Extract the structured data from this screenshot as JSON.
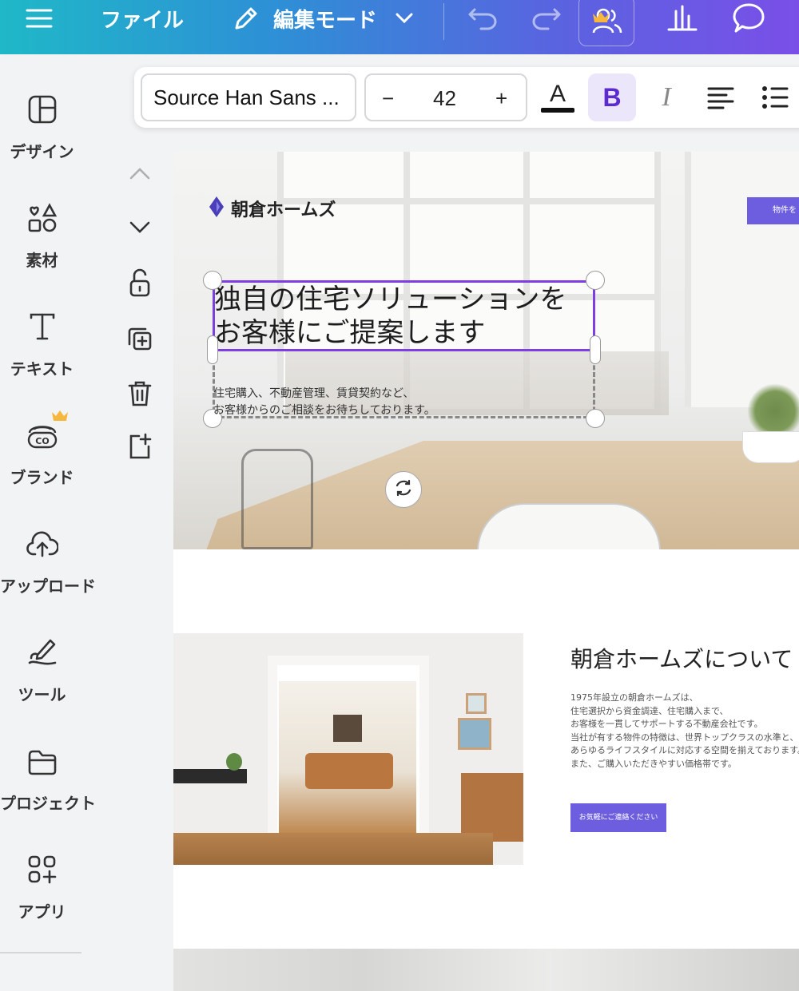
{
  "top_bar": {
    "file_label": "ファイル",
    "edit_mode_label": "編集モード"
  },
  "sidebar": {
    "items": [
      {
        "label": "デザイン",
        "icon": "layout-icon"
      },
      {
        "label": "素材",
        "icon": "elements-icon"
      },
      {
        "label": "テキスト",
        "icon": "text-icon"
      },
      {
        "label": "ブランド",
        "icon": "brand-icon"
      },
      {
        "label": "アップロード",
        "icon": "upload-cloud-icon"
      },
      {
        "label": "ツール",
        "icon": "draw-tool-icon"
      },
      {
        "label": "プロジェクト",
        "icon": "folder-icon"
      },
      {
        "label": "アプリ",
        "icon": "apps-icon"
      }
    ]
  },
  "toolbar": {
    "font_family": "Source Han Sans ...",
    "font_size": "42",
    "minus_label": "−",
    "plus_label": "+",
    "bold_label": "B",
    "italic_label": "I",
    "text_color_label": "A"
  },
  "page": {
    "brand_name": "朝倉ホームズ",
    "nav_button": "物件を",
    "headline_line1": "独自の住宅ソリューションを",
    "headline_line2": "お客様にご提案します",
    "subtext_line1": "住宅購入、不動産管理、賃貸契約など、",
    "subtext_line2": "お客様からのご相談をお待ちしております。",
    "about_title": "朝倉ホームズについて",
    "about_lines": [
      "1975年設立の朝倉ホームズは、",
      "住宅選択から資金調達、住宅購入まで、",
      "お客様を一貫してサポートする不動産会社です。",
      "当社が有する物件の特徴は、世界トップクラスの水準と、",
      "あらゆるライフスタイルに対応する空間を揃えております。",
      "また、ご購入いただきやすい価格帯です。"
    ],
    "contact_button": "お気軽にご連絡ください"
  },
  "colors": {
    "accent_purple": "#7d3fe0",
    "button_purple": "#6d5ee0",
    "bold_bg": "#ece6fb"
  }
}
